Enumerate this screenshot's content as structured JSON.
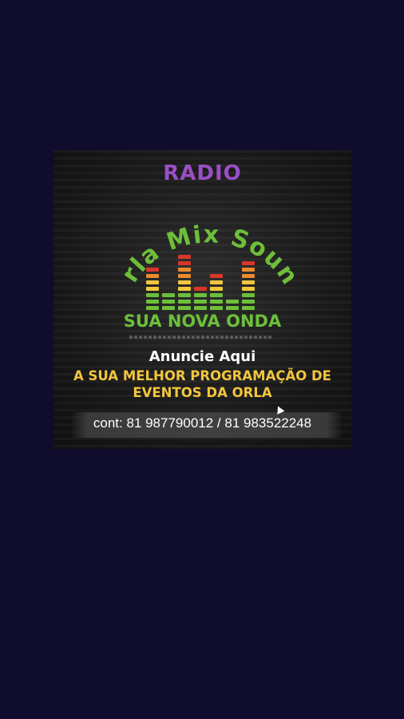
{
  "background_color": "#0f0c2e",
  "banner": {
    "radio": "RADIO",
    "station_name": "Orla Mix Sound",
    "tagline": "SUA NOVA ONDA",
    "announce": "Anuncie Aqui",
    "promo_line1": "A SUA MELHOR PROGRAMAÇÃO DE",
    "promo_line2": "EVENTOS  DA ORLA",
    "contact": "cont: 81 987790012 / 81 983522248",
    "colors": {
      "radio": "#9a4fc6",
      "station_name": "#6dbf3a",
      "tagline": "#6dbf3a",
      "promo": "#f2c53d",
      "eq_green": "#6dbf3a",
      "eq_yellow": "#f2c53d",
      "eq_orange": "#e98a2c",
      "eq_red": "#d9362b"
    },
    "equalizer_levels": [
      7,
      3,
      9,
      4,
      6,
      2,
      8
    ]
  }
}
